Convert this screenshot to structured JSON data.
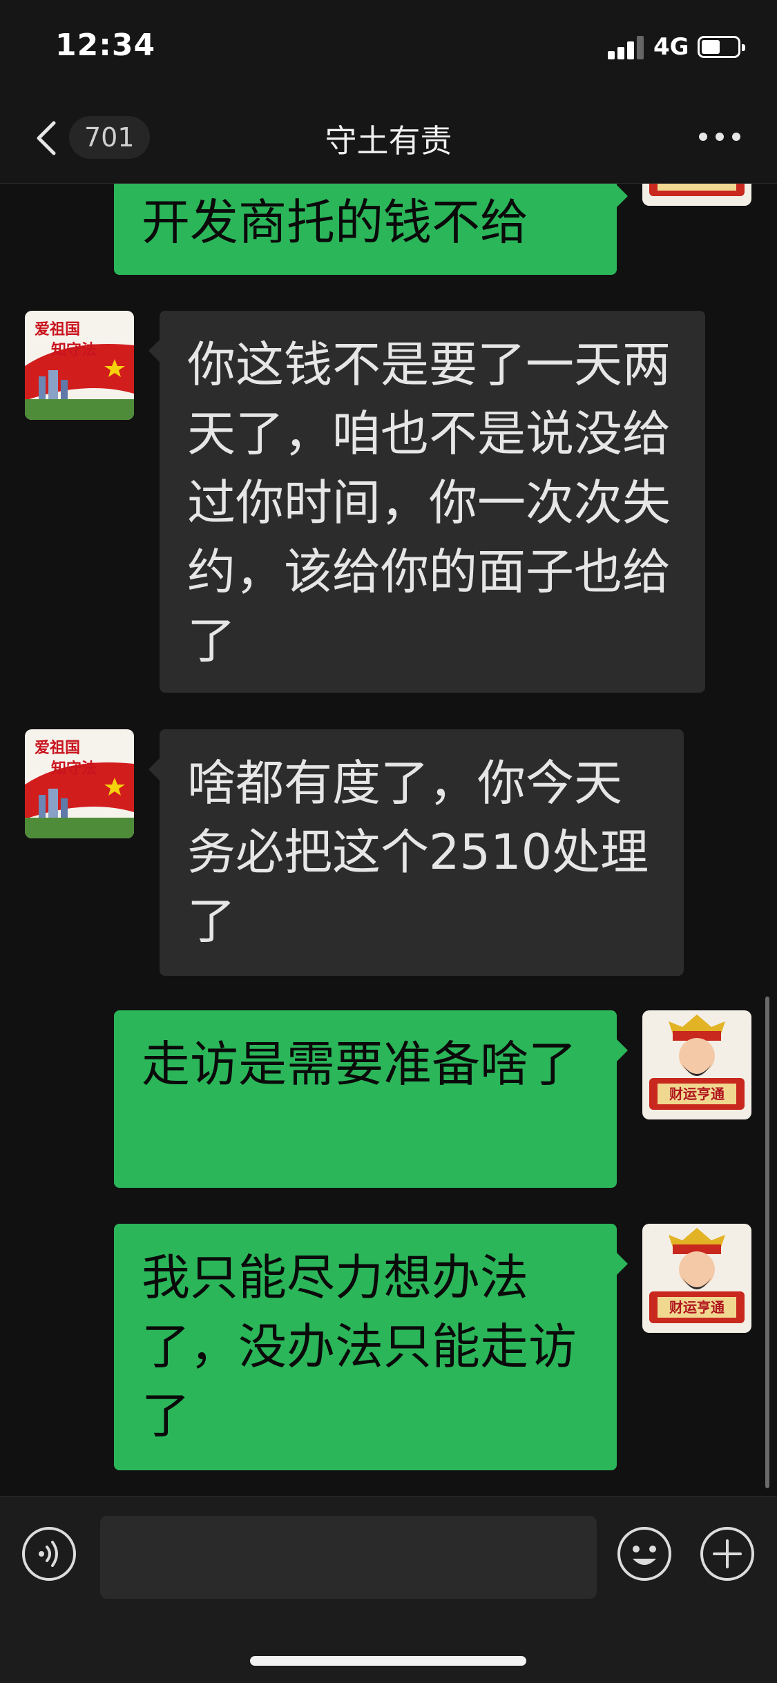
{
  "status_bar": {
    "time": "12:34",
    "network": "4G",
    "battery_level": 0.5
  },
  "header": {
    "back_icon": "chevron-left-icon",
    "unread_count": "701",
    "title": "守土有责",
    "more_icon": "ellipsis-icon"
  },
  "messages": [
    {
      "direction": "out",
      "text": "开发商托的钱不给",
      "avatar": "god-of-wealth-avatar"
    },
    {
      "direction": "in",
      "text": "你这钱不是要了一天两天了，咱也不是说没给过你时间，你一次次失约，该给你的面子也给了",
      "avatar": "patriotic-flag-avatar"
    },
    {
      "direction": "in",
      "text": "啥都有度了，你今天务必把这个2510处理了",
      "avatar": "patriotic-flag-avatar"
    },
    {
      "direction": "out",
      "text": "走访是需要准备啥了",
      "avatar": "god-of-wealth-avatar"
    },
    {
      "direction": "out",
      "text": "我只能尽力想办法了，没办法只能走访了",
      "avatar": "god-of-wealth-avatar"
    }
  ],
  "avatar_text": {
    "incoming": [
      "爱祖国",
      "知守法"
    ],
    "outgoing": "财运亨通"
  },
  "input_bar": {
    "voice_icon": "voice-icon",
    "input_value": "",
    "emoji_icon": "emoji-icon",
    "add_icon": "plus-icon"
  },
  "colors": {
    "background": "#111111",
    "incoming_bubble": "#2c2c2c",
    "outgoing_bubble": "#2bb65a"
  }
}
